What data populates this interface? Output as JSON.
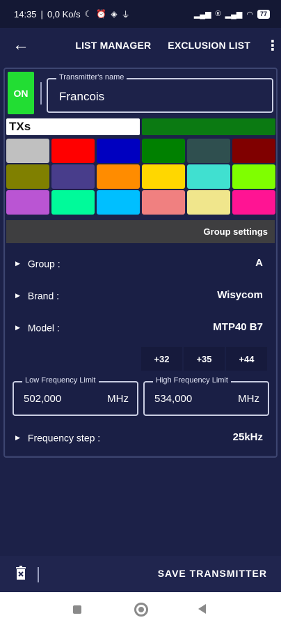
{
  "status_bar": {
    "time": "14:35",
    "speed": "0,0 Ko/s",
    "battery": "77"
  },
  "app_bar": {
    "list_manager": "LIST MANAGER",
    "exclusion_list": "EXCLUSION LIST"
  },
  "transmitter": {
    "on_label": "ON",
    "name_label": "Transmitter's name",
    "name_value": "Francois"
  },
  "tabs": {
    "txs": "TXs",
    "second_color": "#0b7a12"
  },
  "colors": [
    "#c0c0c0",
    "#ff0000",
    "#0000c0",
    "#008000",
    "#2f4f4f",
    "#800000",
    "#808000",
    "#483d8b",
    "#ff8c00",
    "#ffd700",
    "#40e0d0",
    "#7fff00",
    "#ba55d3",
    "#00fa9a",
    "#00bfff",
    "#f08080",
    "#f0e68c",
    "#ff1493"
  ],
  "group_settings": {
    "header": "Group settings",
    "group_label": "Group :",
    "group_value": "A",
    "brand_label": "Brand :",
    "brand_value": "Wisycom",
    "model_label": "Model :",
    "model_value": "MTP40 B7",
    "presets": [
      "+32",
      "+35",
      "+44"
    ],
    "low_label": "Low Frequency Limit",
    "low_value": "502,000",
    "low_unit": "MHz",
    "high_label": "High Frequency Limit",
    "high_value": "534,000",
    "high_unit": "MHz",
    "step_label": "Frequency step :",
    "step_value": "25kHz"
  },
  "bottom_bar": {
    "save_label": "SAVE TRANSMITTER"
  }
}
